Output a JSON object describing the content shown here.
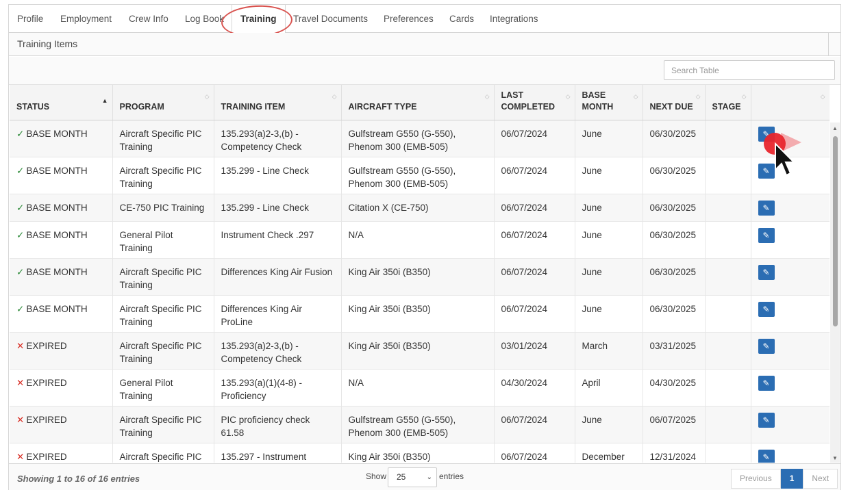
{
  "tabs": [
    {
      "label": "Profile",
      "active": false
    },
    {
      "label": "Employment",
      "active": false
    },
    {
      "label": "Crew Info",
      "active": false
    },
    {
      "label": "Log Book",
      "active": false
    },
    {
      "label": "Training",
      "active": true
    },
    {
      "label": "Travel Documents",
      "active": false
    },
    {
      "label": "Preferences",
      "active": false
    },
    {
      "label": "Cards",
      "active": false
    },
    {
      "label": "Integrations",
      "active": false
    }
  ],
  "panel": {
    "title": "Training Items"
  },
  "search": {
    "placeholder": "Search Table"
  },
  "table": {
    "columns": [
      "STATUS",
      "PROGRAM",
      "TRAINING ITEM",
      "AIRCRAFT TYPE",
      "LAST COMPLETED",
      "BASE MONTH",
      "NEXT DUE",
      "STAGE",
      ""
    ],
    "sorted_column": "STATUS",
    "rows": [
      {
        "status_icon": "check",
        "status": "BASE MONTH",
        "program": "Aircraft Specific PIC Training",
        "training_item": "135.293(a)2-3,(b) - Competency Check",
        "aircraft_type": "Gulfstream G550 (G-550), Phenom 300 (EMB-505)",
        "last_completed": "06/07/2024",
        "base_month": "June",
        "next_due": "06/30/2025",
        "stage": ""
      },
      {
        "status_icon": "check",
        "status": "BASE MONTH",
        "program": "Aircraft Specific PIC Training",
        "training_item": "135.299 - Line Check",
        "aircraft_type": "Gulfstream G550 (G-550), Phenom 300 (EMB-505)",
        "last_completed": "06/07/2024",
        "base_month": "June",
        "next_due": "06/30/2025",
        "stage": ""
      },
      {
        "status_icon": "check",
        "status": "BASE MONTH",
        "program": "CE-750 PIC Training",
        "training_item": "135.299 - Line Check",
        "aircraft_type": "Citation X (CE-750)",
        "last_completed": "06/07/2024",
        "base_month": "June",
        "next_due": "06/30/2025",
        "stage": ""
      },
      {
        "status_icon": "check",
        "status": "BASE MONTH",
        "program": "General Pilot Training",
        "training_item": "Instrument Check .297",
        "aircraft_type": "N/A",
        "last_completed": "06/07/2024",
        "base_month": "June",
        "next_due": "06/30/2025",
        "stage": ""
      },
      {
        "status_icon": "check",
        "status": "BASE MONTH",
        "program": "Aircraft Specific PIC Training",
        "training_item": "Differences King Air Fusion",
        "aircraft_type": "King Air 350i (B350)",
        "last_completed": "06/07/2024",
        "base_month": "June",
        "next_due": "06/30/2025",
        "stage": ""
      },
      {
        "status_icon": "check",
        "status": "BASE MONTH",
        "program": "Aircraft Specific PIC Training",
        "training_item": "Differences King Air ProLine",
        "aircraft_type": "King Air 350i (B350)",
        "last_completed": "06/07/2024",
        "base_month": "June",
        "next_due": "06/30/2025",
        "stage": ""
      },
      {
        "status_icon": "x",
        "status": "EXPIRED",
        "program": "Aircraft Specific PIC Training",
        "training_item": "135.293(a)2-3,(b) - Competency Check",
        "aircraft_type": "King Air 350i (B350)",
        "last_completed": "03/01/2024",
        "base_month": "March",
        "next_due": "03/31/2025",
        "stage": ""
      },
      {
        "status_icon": "x",
        "status": "EXPIRED",
        "program": "General Pilot Training",
        "training_item": "135.293(a)(1)(4-8) - Proficiency",
        "aircraft_type": "N/A",
        "last_completed": "04/30/2024",
        "base_month": "April",
        "next_due": "04/30/2025",
        "stage": ""
      },
      {
        "status_icon": "x",
        "status": "EXPIRED",
        "program": "Aircraft Specific PIC Training",
        "training_item": "PIC proficiency check 61.58",
        "aircraft_type": "Gulfstream G550 (G-550), Phenom 300 (EMB-505)",
        "last_completed": "06/07/2024",
        "base_month": "June",
        "next_due": "06/07/2025",
        "stage": ""
      },
      {
        "status_icon": "x",
        "status": "EXPIRED",
        "program": "Aircraft Specific PIC",
        "training_item": "135.297 - Instrument",
        "aircraft_type": "King Air 350i (B350)",
        "last_completed": "06/07/2024",
        "base_month": "December",
        "next_due": "12/31/2024",
        "stage": ""
      }
    ]
  },
  "footer": {
    "info": "Showing 1 to 16 of 16 entries",
    "show_label": "Show",
    "page_length": "25",
    "entries_label": "entries",
    "prev": "Previous",
    "current_page": "1",
    "next": "Next"
  },
  "colors": {
    "accent": "#2b6db3",
    "ok": "#2e8b3a",
    "expired": "#d9342b",
    "highlight": "#d9534f"
  }
}
